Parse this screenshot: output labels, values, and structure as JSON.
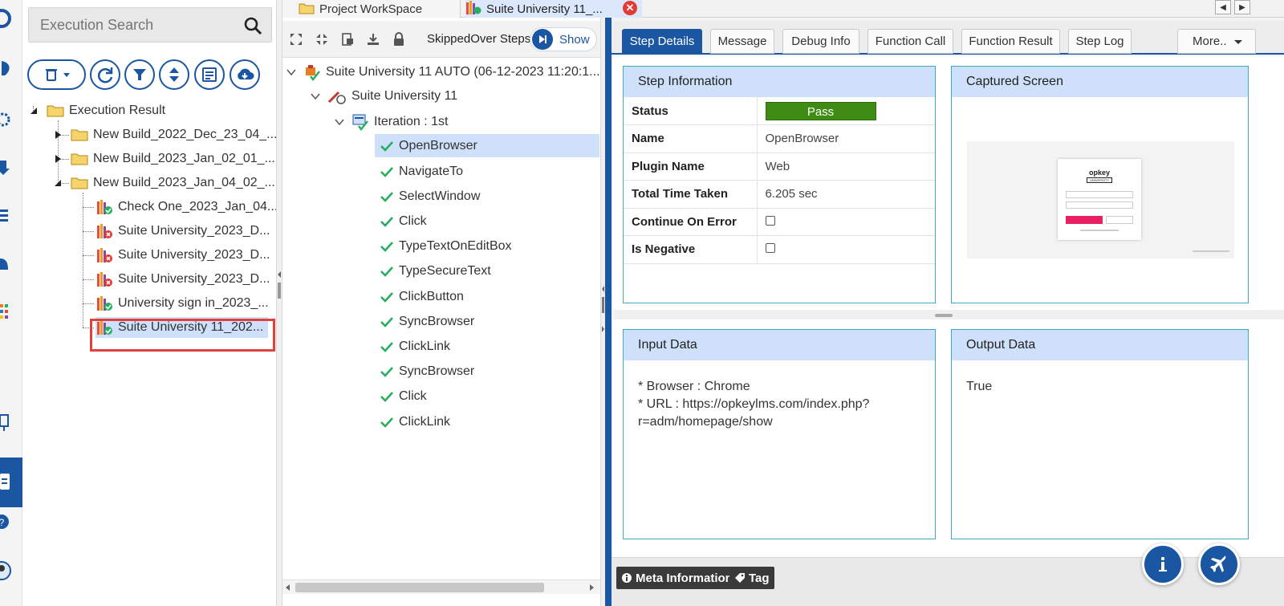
{
  "search": {
    "placeholder": "Execution Search"
  },
  "tabs": [
    {
      "label": "Project WorkSpace"
    },
    {
      "label": "Suite University 11_..."
    }
  ],
  "tree": {
    "root": "Execution Result",
    "builds": [
      "New Build_2022_Dec_23_04_...",
      "New Build_2023_Jan_02_01_...",
      "New Build_2023_Jan_04_02_..."
    ],
    "results": [
      {
        "label": "Check One_2023_Jan_04...",
        "status": "pass"
      },
      {
        "label": "Suite University_2023_D...",
        "status": "fail"
      },
      {
        "label": "Suite University_2023_D...",
        "status": "fail"
      },
      {
        "label": "Suite University_2023_D...",
        "status": "fail"
      },
      {
        "label": "University sign in_2023_...",
        "status": "pass"
      },
      {
        "label": "Suite University 11_202...",
        "status": "pass"
      }
    ]
  },
  "steps_panel": {
    "skipped_label": "SkippedOver Steps",
    "show_label": "Show",
    "suite_root": "Suite University 11 AUTO (06-12-2023 11:20:1...",
    "suite": "Suite University 11",
    "iteration": "Iteration : 1st",
    "steps": [
      "OpenBrowser",
      "NavigateTo",
      "SelectWindow",
      "Click",
      "TypeTextOnEditBox",
      "TypeSecureText",
      "ClickButton",
      "SyncBrowser",
      "ClickLink",
      "SyncBrowser",
      "Click",
      "ClickLink"
    ]
  },
  "detail_tabs": [
    "Step Details",
    "Message",
    "Debug Info",
    "Function Call",
    "Function Result",
    "Step Log",
    "More.."
  ],
  "step_info": {
    "title": "Step Information",
    "status_label": "Status",
    "status_value": "Pass",
    "name_label": "Name",
    "name_value": "OpenBrowser",
    "plugin_label": "Plugin Name",
    "plugin_value": "Web",
    "time_label": "Total Time Taken",
    "time_value": "6.205 sec",
    "coe_label": "Continue On Error",
    "neg_label": "Is Negative"
  },
  "captured": {
    "title": "Captured Screen",
    "brand": "opkey",
    "brand_sub": "UNIVERSITY"
  },
  "input_data": {
    "title": "Input Data",
    "lines": [
      "* Browser : Chrome",
      "* URL : https://opkeylms.com/index.php?",
      "r=adm/homepage/show"
    ]
  },
  "output_data": {
    "title": "Output Data",
    "value": "True"
  },
  "bottom": {
    "meta": "Meta Information",
    "tag": "Tag"
  },
  "colors": {
    "accent": "#1b56a3",
    "pass": "#3e8c14",
    "highlight": "#e0413f"
  }
}
